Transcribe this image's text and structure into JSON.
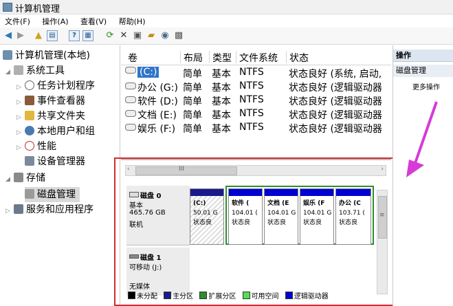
{
  "window": {
    "title": "计算机管理"
  },
  "menu": [
    "文件(F)",
    "操作(A)",
    "查看(V)",
    "帮助(H)"
  ],
  "tree": {
    "root": "计算机管理(本地)",
    "system_tools": "系统工具",
    "task_scheduler": "任务计划程序",
    "event_viewer": "事件查看器",
    "shared_folders": "共享文件夹",
    "local_users": "本地用户和组",
    "performance": "性能",
    "device_manager": "设备管理器",
    "storage": "存储",
    "disk_management": "磁盘管理",
    "services": "服务和应用程序"
  },
  "volume_table": {
    "headers": [
      "卷",
      "布局",
      "类型",
      "文件系统",
      "状态"
    ],
    "rows": [
      [
        "(C:)",
        "简单",
        "基本",
        "NTFS",
        "状态良好 (系统, 启动,"
      ],
      [
        "办公 (G:)",
        "简单",
        "基本",
        "NTFS",
        "状态良好 (逻辑驱动器"
      ],
      [
        "软件 (D:)",
        "简单",
        "基本",
        "NTFS",
        "状态良好 (逻辑驱动器"
      ],
      [
        "文档 (E:)",
        "简单",
        "基本",
        "NTFS",
        "状态良好 (逻辑驱动器"
      ],
      [
        "娱乐 (F:)",
        "简单",
        "基本",
        "NTFS",
        "状态良好 (逻辑驱动器"
      ]
    ]
  },
  "scroll_glyph": "III",
  "vscroll_glyph": "≡",
  "disk0": {
    "name": "磁盘 0",
    "type": "基本",
    "size": "465.76 GB",
    "status": "联机"
  },
  "disk1": {
    "name": "磁盘 1",
    "type": "可移动 (J:)",
    "status": "无媒体"
  },
  "partitions": [
    {
      "name": "(C:)",
      "size": "50.01 G",
      "status": "状态良",
      "color": "#1a1a8c"
    },
    {
      "name": "软件 (",
      "size": "104.01 (",
      "status": "状态良",
      "color": "#0000d0"
    },
    {
      "name": "文档 (E",
      "size": "104.01 G",
      "status": "状态良",
      "color": "#0000d0"
    },
    {
      "name": "娱乐 (F",
      "size": "104.01 G",
      "status": "状态良",
      "color": "#0000d0"
    },
    {
      "name": "办公 (C",
      "size": "103.71 (",
      "status": "状态良",
      "color": "#0000d0"
    }
  ],
  "legend": [
    {
      "label": "未分配",
      "color": "#000000"
    },
    {
      "label": "主分区",
      "color": "#1a1a8c"
    },
    {
      "label": "扩展分区",
      "color": "#2e8b2e"
    },
    {
      "label": "可用空间",
      "color": "#55dd55"
    },
    {
      "label": "逻辑驱动器",
      "color": "#0000d0"
    }
  ],
  "actions": {
    "header": "操作",
    "section": "磁盘管理",
    "more": "更多操作"
  },
  "colors": {
    "annotation_red": "#d7292f",
    "annotation_arrow": "#d63bd6",
    "extended_green": "#2e8b2e"
  }
}
